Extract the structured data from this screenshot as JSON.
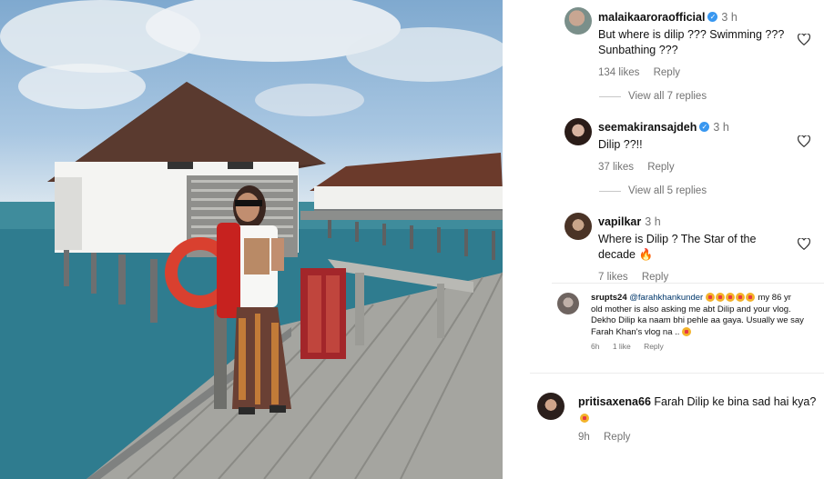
{
  "comments": [
    {
      "username": "malaikaaroraofficial",
      "verified": true,
      "time": "3 h",
      "text_line1": "But where is dilip ??? Swimming ???",
      "text_line2": "Sunbathing ???",
      "likes": "134 likes",
      "reply": "Reply",
      "view_replies": "View all 7 replies"
    },
    {
      "username": "seemakiransajdeh",
      "verified": true,
      "time": "3 h",
      "text_line1": "Dilip ??!!",
      "likes": "37 likes",
      "reply": "Reply",
      "view_replies": "View all 5 replies"
    },
    {
      "username": "vapilkar",
      "verified": false,
      "time": "3 h",
      "text_line1": "Where is Dilip ? The Star of the",
      "text_line2": "decade 🔥",
      "likes": "7 likes",
      "reply": "Reply"
    },
    {
      "username": "srupts24",
      "mention": "@farahkhankunder",
      "text_tail1": "my 86 yr",
      "text_line2": "old mother is also asking me abt Dilip and your vlog.",
      "text_line3": "Dekho Dilip ka naam bhi pehle aa gaya. Usually we say",
      "text_line4": "Farah Khan's vlog na ..",
      "time": "6h",
      "likes": "1 like",
      "reply": "Reply"
    },
    {
      "username": "pritisaxena66",
      "text_line1": "Farah Dilip ke bina sad hai kya?",
      "time": "9h",
      "reply": "Reply"
    }
  ],
  "colors": {
    "verified": "#3897f0",
    "meta": "#737373",
    "mention": "#00376b"
  },
  "icons": [
    "heart-icon",
    "verified-badge-icon"
  ]
}
